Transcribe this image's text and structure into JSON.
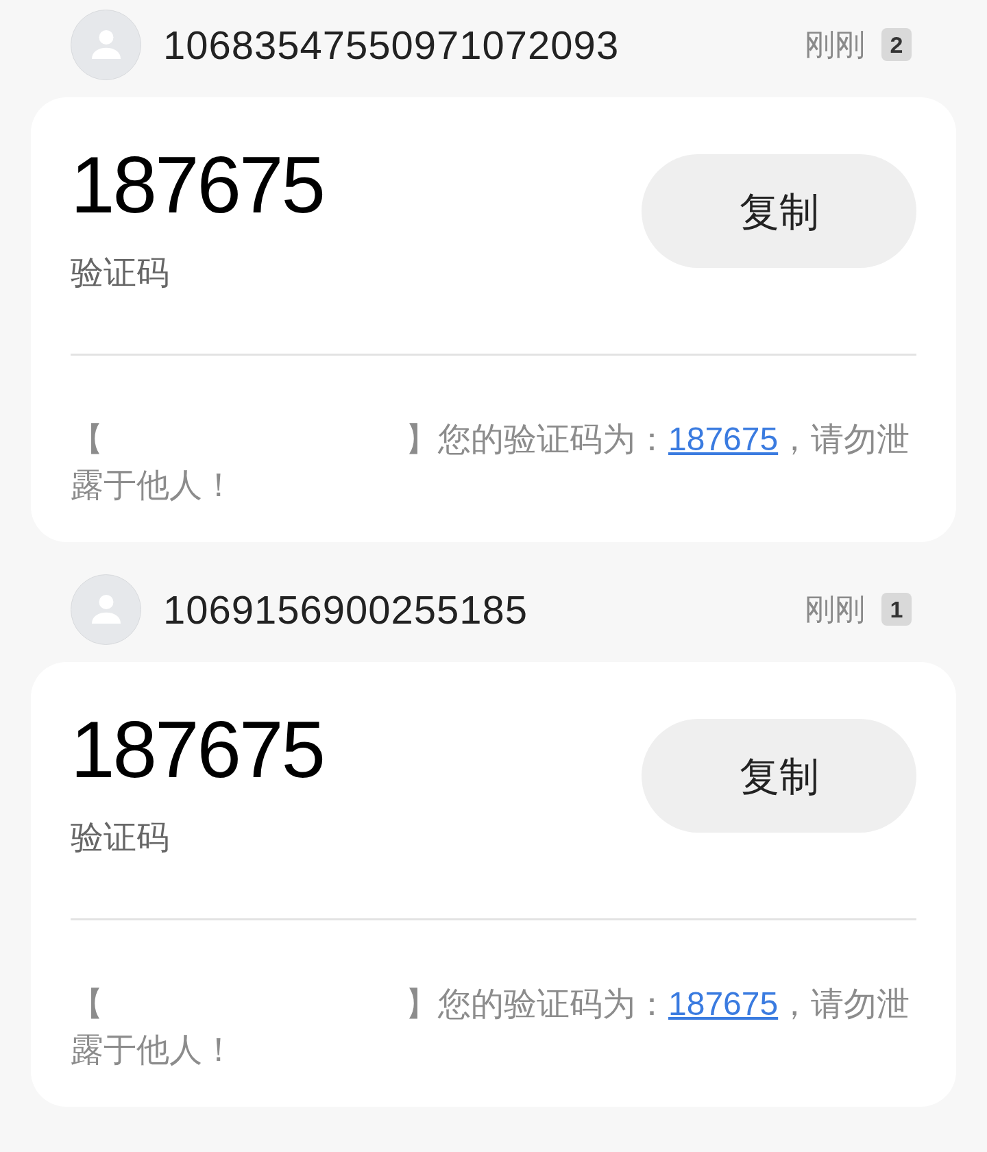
{
  "conversations": [
    {
      "sender": "10683547550971072093",
      "time": "刚刚",
      "unread": "2",
      "code": "187675",
      "code_label": "验证码",
      "copy_button": "复制",
      "message": {
        "open_bracket": "【",
        "lead": "】您的验证码为：",
        "code_link": "187675",
        "tail": "，请勿泄露于他人！"
      }
    },
    {
      "sender": "1069156900255185",
      "time": "刚刚",
      "unread": "1",
      "code": "187675",
      "code_label": "验证码",
      "copy_button": "复制",
      "message": {
        "open_bracket": "【",
        "lead": "】您的验证码为：",
        "code_link": "187675",
        "tail": "，请勿泄露于他人！"
      }
    }
  ]
}
